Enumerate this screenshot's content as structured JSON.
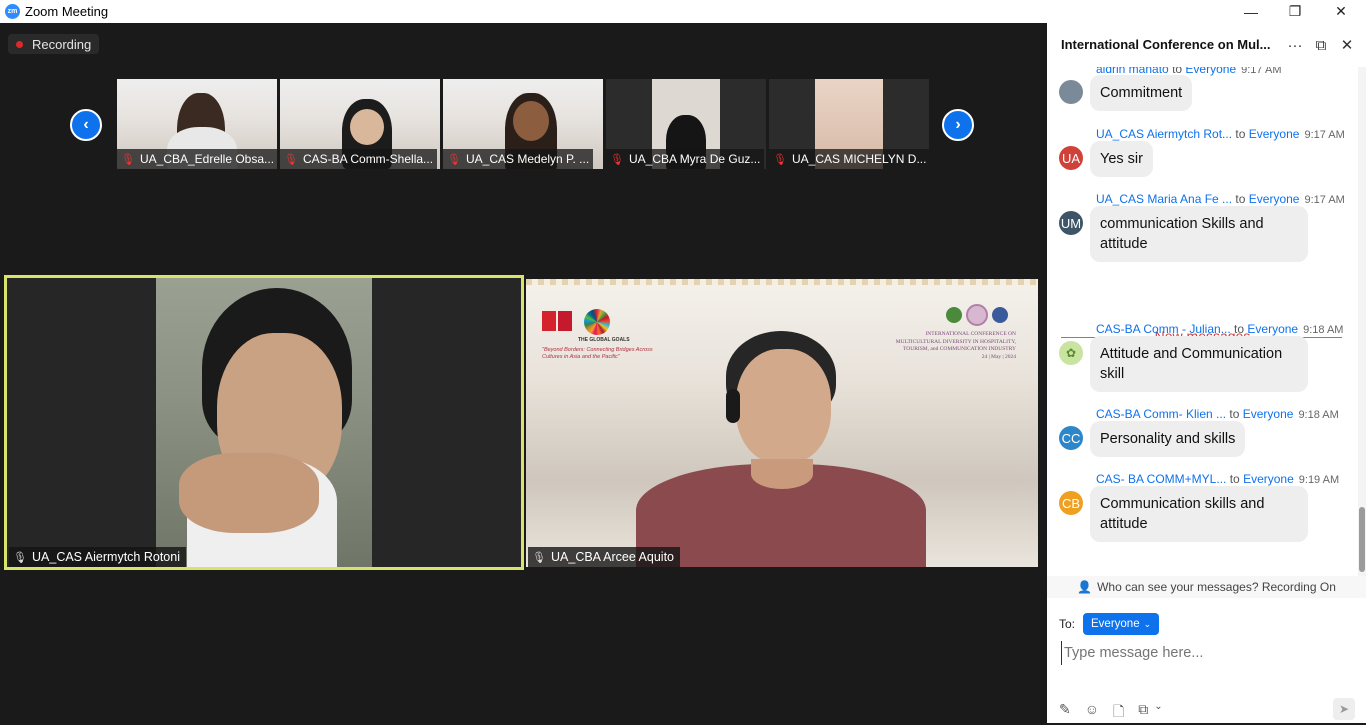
{
  "window": {
    "title": "Zoom Meeting",
    "logo_text": "zm",
    "minimize": "—",
    "restore": "❐",
    "close": "✕"
  },
  "meeting": {
    "recording_label": "Recording",
    "prev_icon": "‹",
    "next_icon": "›",
    "thumbnails": [
      {
        "name": "UA_CBA_Edrelle Obsa..."
      },
      {
        "name": "CAS-BA Comm-Shella..."
      },
      {
        "name": "UA_CAS Medelyn P. ..."
      },
      {
        "name": "UA_CBA Myra De Guz..."
      },
      {
        "name": "UA_CAS MICHELYN D..."
      }
    ],
    "tiles": [
      {
        "name": "UA_CAS Aiermytch Rotoni",
        "highlight_color": "#d7e36a"
      },
      {
        "name": "UA_CBA Arcee Aquito"
      }
    ],
    "banner": {
      "line1": "INTERNATIONAL CONFERENCE ON",
      "line2": "MULTICULTURAL DIVERSITY IN HOSPITALITY,",
      "line3": "TOURISM, and COMMUNICATION INDUSTRY",
      "date": "24 | May | 2024",
      "tagline": "\"Beyond Borders: Connecting Bridges Across Cultures in Asia and the Pacific\"",
      "goals": "THE GLOBAL GOALS"
    }
  },
  "chat": {
    "title": "International Conference on Mul...",
    "more_icon": "···",
    "popout_icon": "⧉",
    "close_icon": "✕",
    "to_word": "to",
    "messages": [
      {
        "sender": "aldrin manato",
        "to": "Everyone",
        "time": "9:17 AM",
        "text": "Commitment",
        "avatar": "",
        "avatar_color": "#7a8a99"
      },
      {
        "sender": "UA_CAS Aiermytch Rot...",
        "to": "Everyone",
        "time": "9:17 AM",
        "text": "Yes sir",
        "avatar": "UA",
        "avatar_color": "#d0413a"
      },
      {
        "sender": "UA_CAS Maria Ana Fe ...",
        "to": "Everyone",
        "time": "9:17 AM",
        "text": " communication Skills and attitude",
        "avatar": "UM",
        "avatar_color": "#3d5566"
      },
      {
        "sender": "CAS-BA Comm - Julian...",
        "to": "Everyone",
        "time": "9:18 AM",
        "text": "Attitude and Communication skill",
        "avatar": "",
        "avatar_color": "#c9e3a0"
      },
      {
        "sender": "CAS-BA Comm- Klien ...",
        "to": "Everyone",
        "time": "9:18 AM",
        "text": "Personality and skills",
        "avatar": "CC",
        "avatar_color": "#2d86c9"
      },
      {
        "sender": "CAS- BA COMM+MYL...",
        "to": "Everyone",
        "time": "9:19 AM",
        "text": "Communication skills and attitude",
        "avatar": "CB",
        "avatar_color": "#f0a020"
      }
    ],
    "new_messages_label": "New messages",
    "who_can_see": "Who can see your messages? Recording On",
    "to_label": "To:",
    "recipient": "Everyone",
    "input_placeholder": "Type message here..."
  },
  "colors": {
    "accent": "#0e72ed",
    "recording_dot": "#e02828",
    "new_messages": "#d23a3a"
  }
}
